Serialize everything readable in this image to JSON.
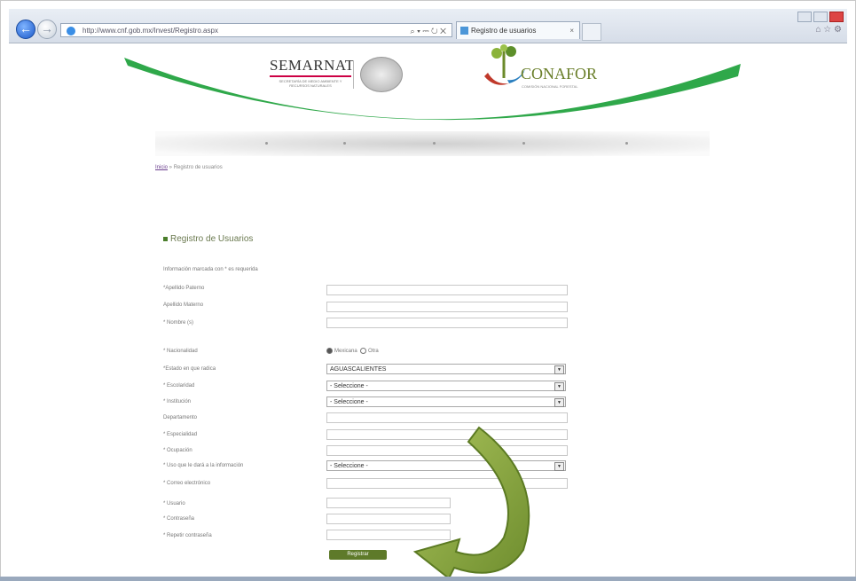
{
  "browser": {
    "address": "http://www.cnf.gob.mx/Invest/Registro.aspx",
    "address_tools": "⌕ ▾ ⎓ ↻ ✕",
    "tab_title": "Registro de usuarios",
    "tab_close": "×"
  },
  "header": {
    "semarnat_title": "SEMARNAT",
    "semarnat_subtitle": "SECRETARÍA DE MEDIO AMBIENTE Y RECURSOS NATURALES",
    "conafor_title": "CONAFOR",
    "conafor_subtitle": "COMISIÓN NACIONAL FORESTAL"
  },
  "breadcrumb": {
    "home": "Inicio",
    "separator": " » ",
    "current": "Registro de usuarios"
  },
  "form": {
    "title": "Registro de Usuarios",
    "note": "Información marcada con * es requerida",
    "labels": {
      "apellido_paterno": "*Apellido Paterno",
      "apellido_materno": "Apellido Materno",
      "nombre": "* Nombre (s)",
      "nacionalidad": "* Nacionalidad",
      "estado": "*Estado en que radica",
      "escolaridad": "* Escolaridad",
      "institucion": "* Institución",
      "departamento": "Departamento",
      "especialidad": "* Especialidad",
      "ocupacion": "* Ocupación",
      "uso": "* Uso que le dará a la información",
      "correo": "* Correo electrónico",
      "usuario": "* Usuario",
      "contrasena": "* Contraseña",
      "repetir": "* Repetir contraseña"
    },
    "nacionalidad_options": {
      "mexicana": "Mexicana",
      "otra": "Otra"
    },
    "estado_value": "AGUASCALIENTES",
    "escolaridad_value": "- Seleccione -",
    "institucion_value": "- Seleccione -",
    "uso_value": "- Seleccione -",
    "submit_label": "Registrar"
  },
  "colors": {
    "brand_green": "#2fa84a",
    "button_green": "#5e7a2a",
    "arrow_green": "#7d9b3a"
  }
}
